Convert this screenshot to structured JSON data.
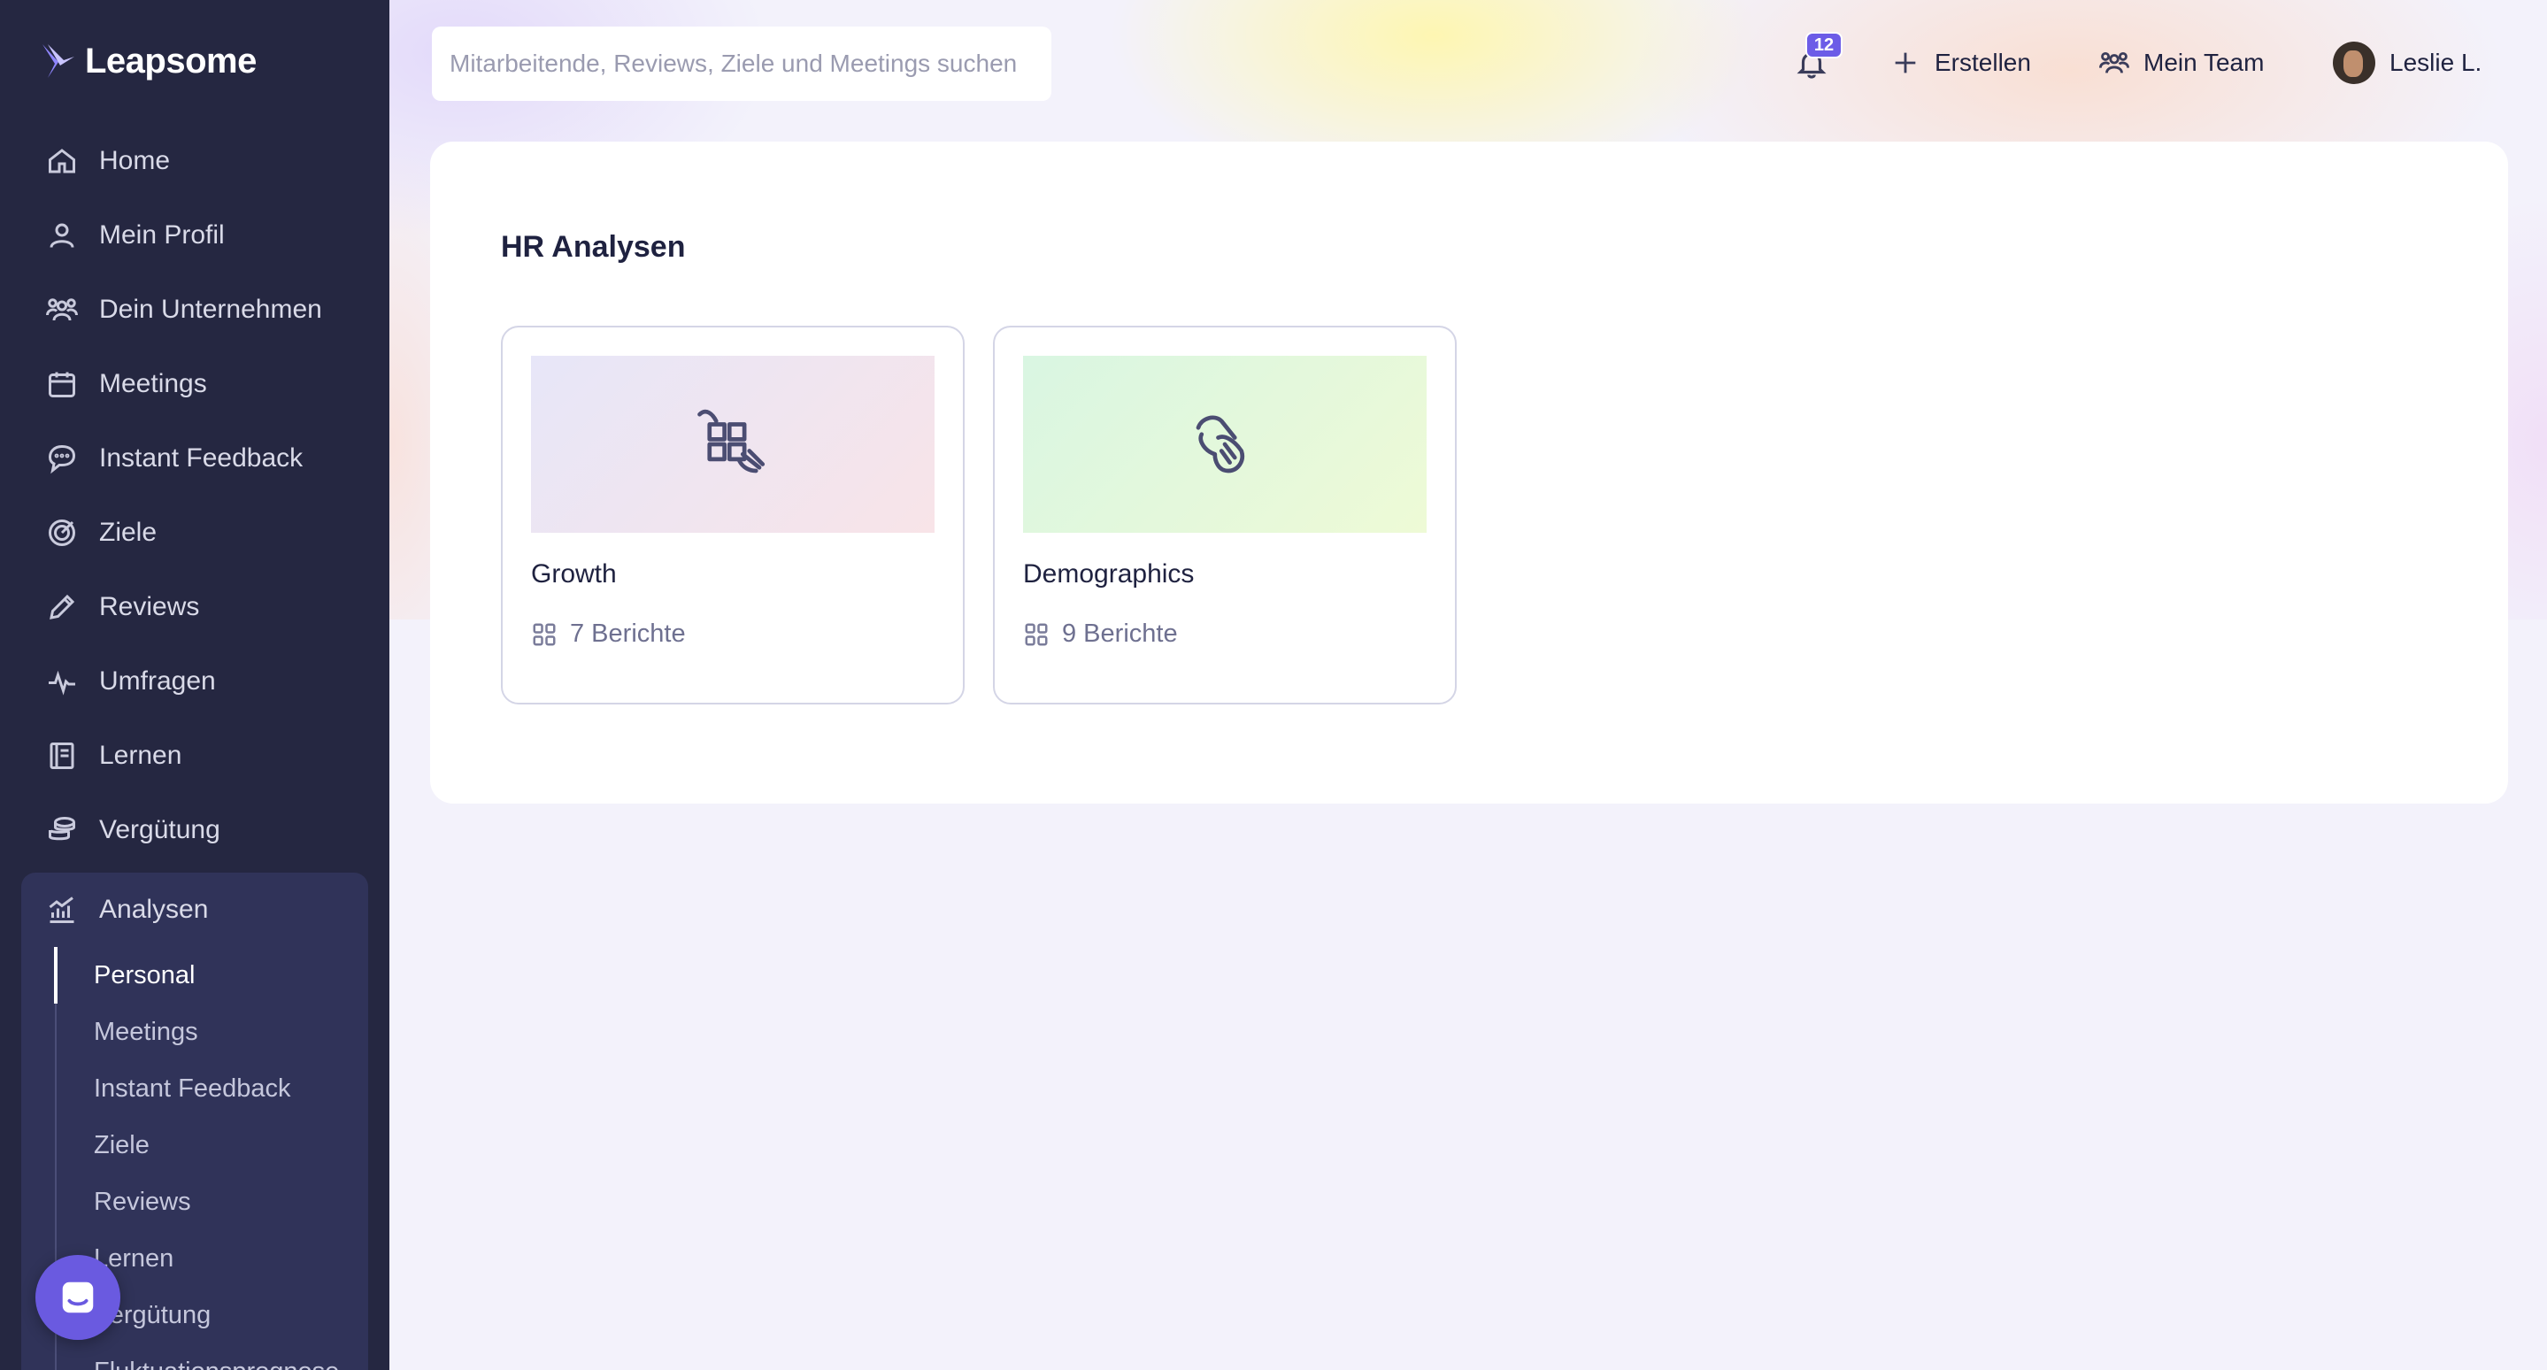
{
  "app": {
    "brand": "Leapsome"
  },
  "search": {
    "placeholder": "Mitarbeitende, Reviews, Ziele und Meetings suchen"
  },
  "topbar": {
    "notification_count": "12",
    "create_label": "Erstellen",
    "team_label": "Mein Team",
    "user_name": "Leslie L."
  },
  "sidebar": {
    "items": [
      {
        "label": "Home",
        "icon": "home-icon"
      },
      {
        "label": "Mein Profil",
        "icon": "user-icon"
      },
      {
        "label": "Dein Unternehmen",
        "icon": "users-icon"
      },
      {
        "label": "Meetings",
        "icon": "calendar-icon"
      },
      {
        "label": "Instant Feedback",
        "icon": "chat-icon"
      },
      {
        "label": "Ziele",
        "icon": "target-icon"
      },
      {
        "label": "Reviews",
        "icon": "pencil-icon"
      },
      {
        "label": "Umfragen",
        "icon": "pulse-icon"
      },
      {
        "label": "Lernen",
        "icon": "book-icon"
      },
      {
        "label": "Vergütung",
        "icon": "coins-icon"
      }
    ],
    "analytics": {
      "label": "Analysen",
      "icon": "chart-icon",
      "sub_items": [
        {
          "label": "Personal",
          "active": true
        },
        {
          "label": "Meetings"
        },
        {
          "label": "Instant Feedback"
        },
        {
          "label": "Ziele"
        },
        {
          "label": "Reviews"
        },
        {
          "label": "Lernen"
        },
        {
          "label": "Vergütung"
        },
        {
          "label": "Fluktuationsprognose"
        }
      ]
    }
  },
  "main": {
    "title": "HR Analysen",
    "tiles": [
      {
        "name": "Growth",
        "reports": "7 Berichte",
        "icon": "puzzle-hand-icon",
        "colors": [
          "#e7e6f8",
          "#f8e4e8"
        ]
      },
      {
        "name": "Demographics",
        "reports": "9 Berichte",
        "icon": "hands-icon",
        "colors": [
          "#d9f6e2",
          "#eefad6"
        ]
      }
    ]
  }
}
